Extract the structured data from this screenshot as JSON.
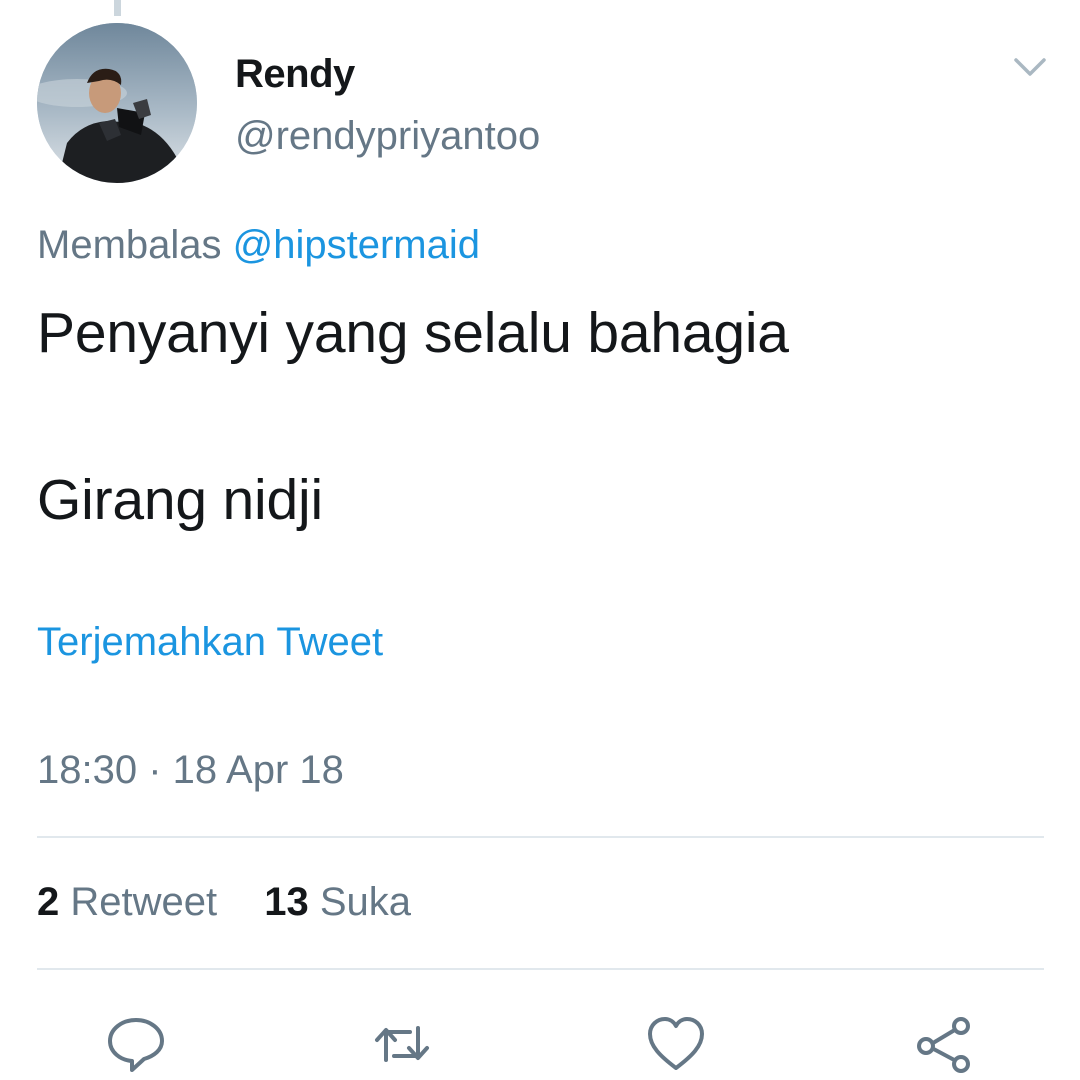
{
  "tweet": {
    "display_name": "Rendy",
    "handle": "@rendypriyantoo",
    "reply_prefix": "Membalas",
    "reply_mention": "@hipstermaid",
    "text_line1": "Penyanyi yang selalu bahagia",
    "text_line2": "Girang nidji",
    "translate_link": "Terjemahkan Tweet",
    "timestamp": "18:30 · 18 Apr 18"
  },
  "stats": {
    "retweet_count": "2",
    "retweet_label": "Retweet",
    "like_count": "13",
    "like_label": "Suka"
  },
  "icons": {
    "caret": "chevron-down-icon",
    "reply": "reply-icon",
    "retweet": "retweet-icon",
    "like": "heart-icon",
    "share": "share-icon"
  },
  "colors": {
    "link": "#1b95e0",
    "secondary_text": "#657786",
    "primary_text": "#14171a",
    "divider": "#e1e8ed",
    "action_icon": "#657786"
  }
}
